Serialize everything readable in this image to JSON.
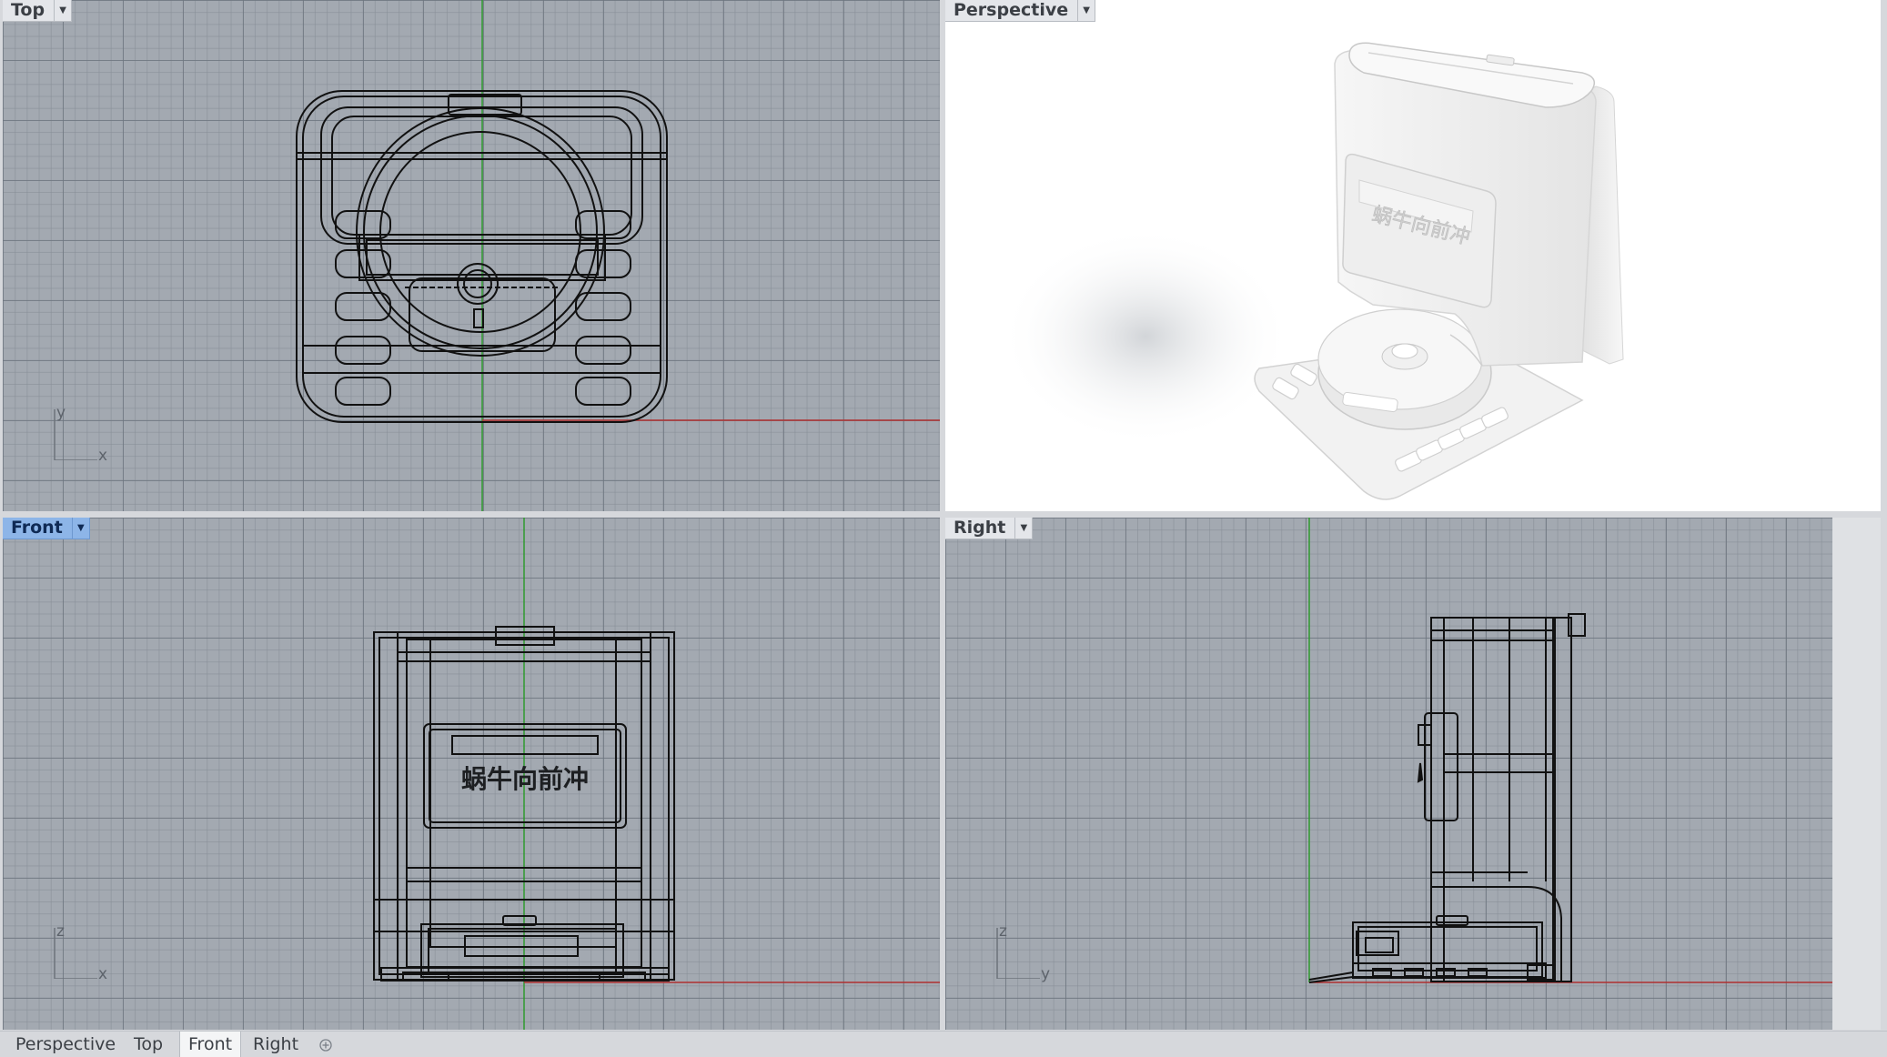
{
  "viewports": {
    "top": {
      "label": "Top",
      "axes": {
        "a": "y",
        "b": "x"
      }
    },
    "perspective": {
      "label": "Perspective"
    },
    "front": {
      "label": "Front",
      "axes": {
        "a": "z",
        "b": "x"
      },
      "embossed_text": "蜗牛向前冲"
    },
    "right": {
      "label": "Right",
      "axes": {
        "a": "z",
        "b": "y"
      }
    }
  },
  "tabs": [
    "Perspective",
    "Top",
    "Front",
    "Right"
  ],
  "active_tab": "Front",
  "add_tab_icon": "plus-circle-icon",
  "dropdown_icon": "triangle-down-icon",
  "colors": {
    "grid_bg": "#a3a9b1",
    "x_axis": "#b03030",
    "y_axis": "#2f9a2f",
    "wire": "#111111",
    "active_label": "#8db5e8"
  }
}
